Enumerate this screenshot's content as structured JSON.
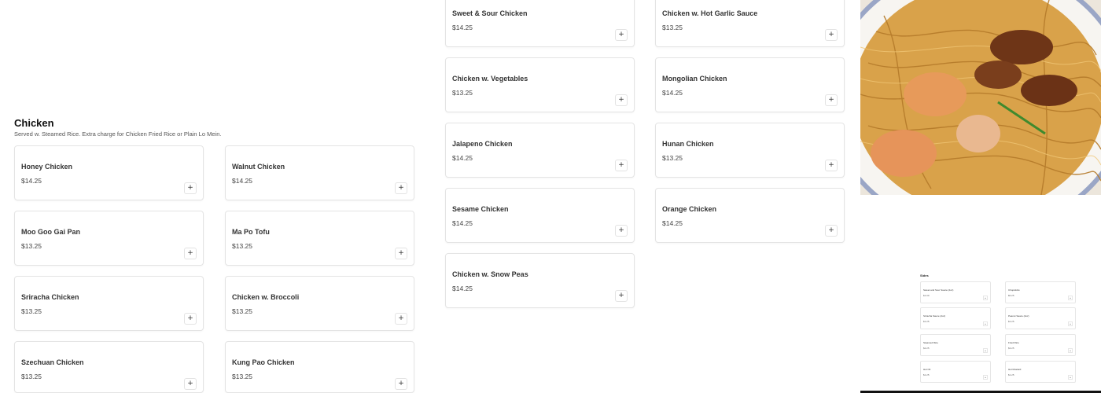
{
  "section": {
    "title": "Chicken",
    "description": "Served w. Steamed Rice. Extra charge for Chicken Fried Rice or Plain Lo Mein."
  },
  "add_symbol": "+",
  "items_left": [
    {
      "name": "Honey Chicken",
      "price": "$14.25"
    },
    {
      "name": "Walnut Chicken",
      "price": "$14.25"
    },
    {
      "name": "Moo Goo Gai Pan",
      "price": "$13.25"
    },
    {
      "name": "Ma Po Tofu",
      "price": "$13.25"
    },
    {
      "name": "Sriracha Chicken",
      "price": "$13.25"
    },
    {
      "name": "Chicken w. Broccoli",
      "price": "$13.25"
    },
    {
      "name": "Szechuan Chicken",
      "price": "$13.25"
    },
    {
      "name": "Kung Pao Chicken",
      "price": "$13.25"
    }
  ],
  "items_right": [
    {
      "name": "Sweet & Sour Chicken",
      "price": "$14.25"
    },
    {
      "name": "Chicken w. Hot Garlic Sauce",
      "price": "$13.25"
    },
    {
      "name": "Chicken w. Vegetables",
      "price": "$13.25"
    },
    {
      "name": "Mongolian Chicken",
      "price": "$14.25"
    },
    {
      "name": "Jalapeno Chicken",
      "price": "$14.25"
    },
    {
      "name": "Hunan Chicken",
      "price": "$13.25"
    },
    {
      "name": "Sesame Chicken",
      "price": "$14.25"
    },
    {
      "name": "Orange Chicken",
      "price": "$14.25"
    },
    {
      "name": "Chicken w. Snow Peas",
      "price": "$14.25"
    }
  ],
  "sides_preview": {
    "title": "Sides",
    "items": [
      {
        "name": "Sweet and Sour Sauce (2oz)",
        "price": "$1.00"
      },
      {
        "name": "Chopsticks",
        "price": "$0.25"
      },
      {
        "name": "Sriracha Sauce (2oz)",
        "price": "$1.25"
      },
      {
        "name": "Peanut Sauce (2oz)",
        "price": "$1.25"
      },
      {
        "name": "Steamed Rice",
        "price": "$2.25"
      },
      {
        "name": "Fried Rice",
        "price": "$3.25"
      },
      {
        "name": "Hot Oil",
        "price": "$1.25"
      },
      {
        "name": "Hot Mustard",
        "price": "$1.25"
      }
    ]
  },
  "colors": {
    "border": "#e4e4e4",
    "text": "#1f1f1f",
    "noodle": "#d49a3c",
    "chicken": "#7a3e1c"
  }
}
